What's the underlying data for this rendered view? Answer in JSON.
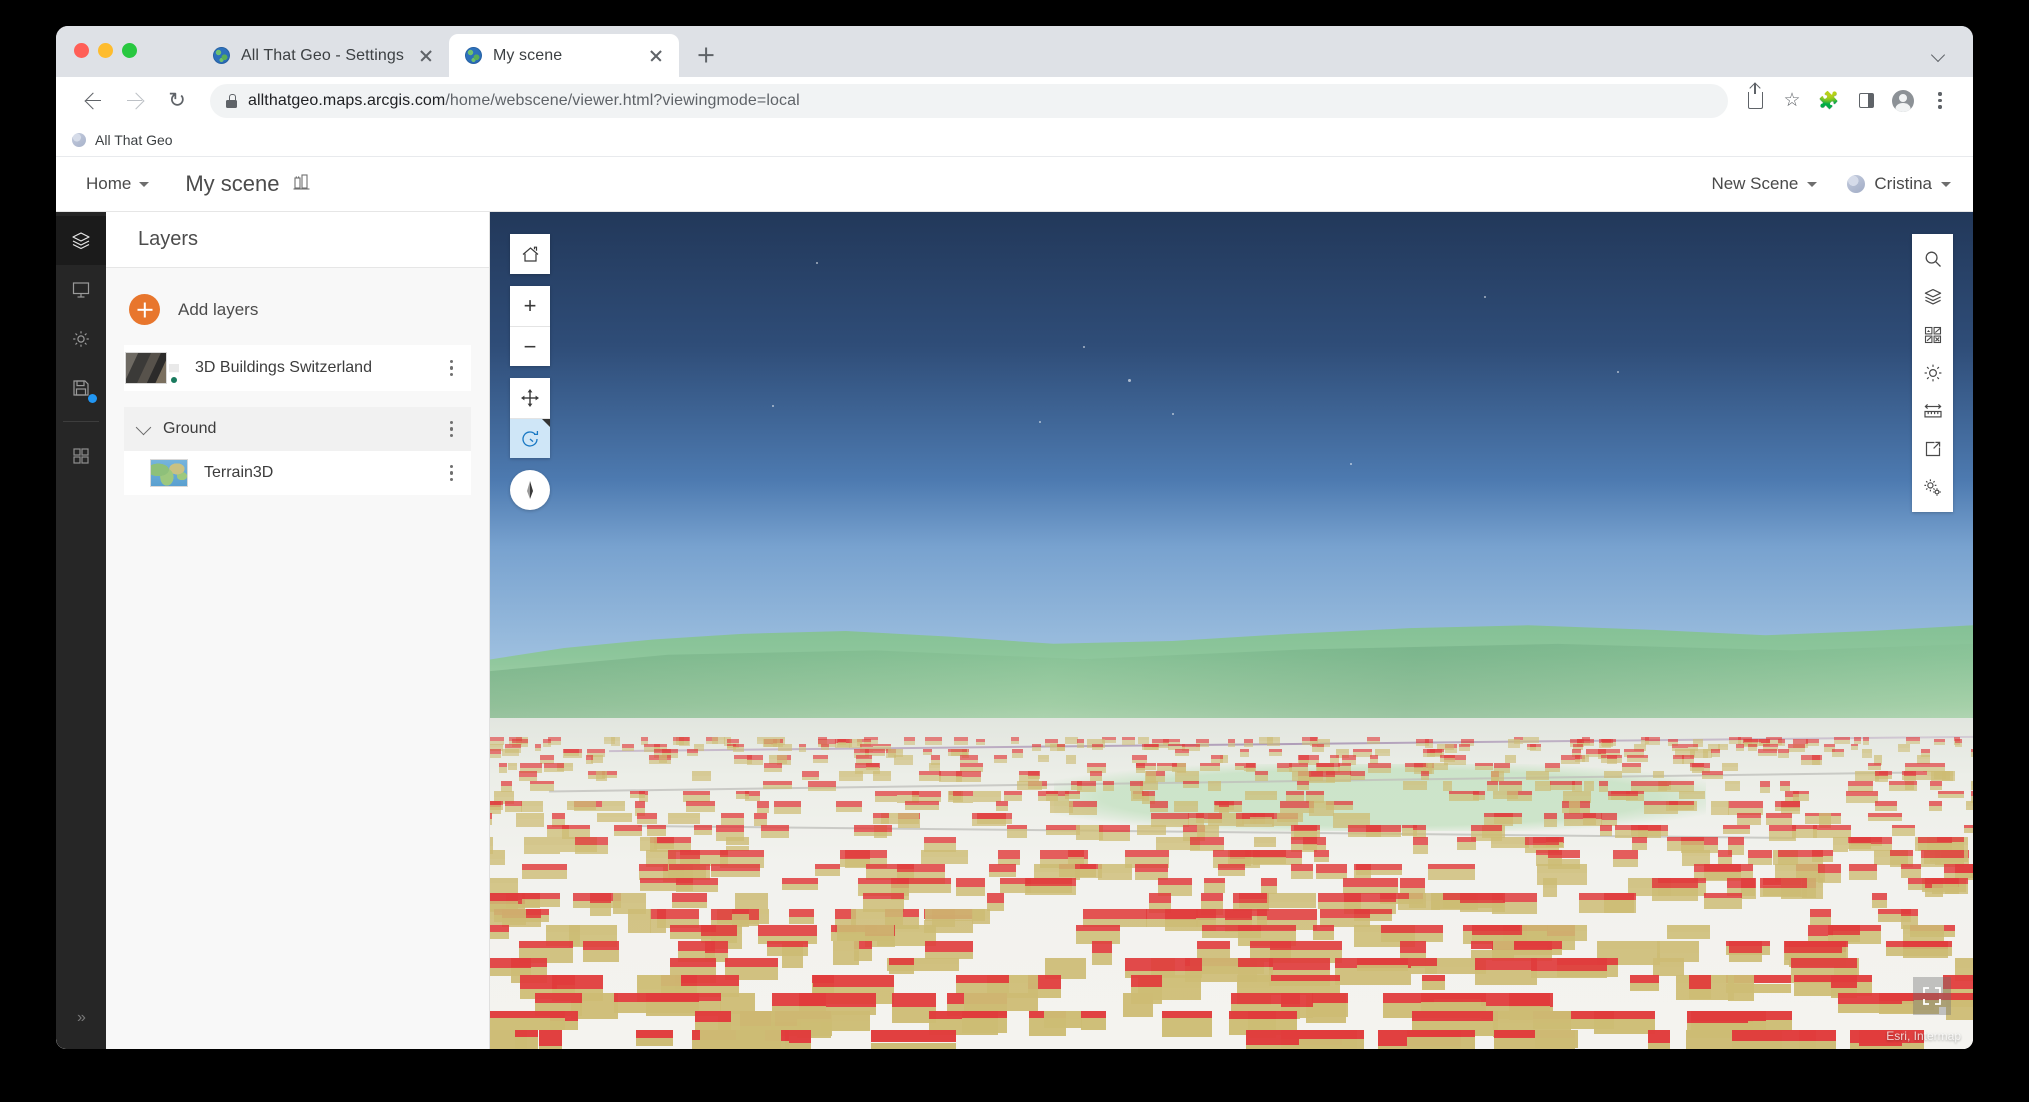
{
  "browser": {
    "tabs": [
      {
        "title": "All That Geo - Settings",
        "active": false,
        "favicon": "globe-favicon"
      },
      {
        "title": "My scene",
        "active": true,
        "favicon": "globe-favicon"
      }
    ],
    "new_tab_label": "+",
    "url_domain": "allthatgeo.maps.arcgis.com",
    "url_path": "/home/webscene/viewer.html?viewingmode=local",
    "toolbar_icons": [
      "share-icon",
      "bookmark-star-icon",
      "extensions-puzzle-icon",
      "side-panel-icon",
      "profile-avatar-icon",
      "chrome-menu-icon"
    ],
    "bookmarks": [
      {
        "label": "All That Geo",
        "favicon": "globe-favicon"
      }
    ]
  },
  "app_header": {
    "home_label": "Home",
    "scene_title": "My scene",
    "scene_icon": "3d-scene-icon",
    "new_scene_label": "New Scene",
    "user_name": "Cristina"
  },
  "rail": {
    "items": [
      {
        "name": "layers",
        "icon": "layers-stack-icon",
        "active": true,
        "badge": false
      },
      {
        "name": "slides",
        "icon": "presentation-icon",
        "active": false,
        "badge": false
      },
      {
        "name": "settings",
        "icon": "gear-icon",
        "active": false,
        "badge": false
      },
      {
        "name": "save",
        "icon": "floppy-save-icon",
        "active": false,
        "badge": true
      }
    ],
    "grid_item": {
      "name": "basemap-gallery",
      "icon": "grid-squares-icon"
    },
    "expand_label": "»"
  },
  "layers_panel": {
    "title": "Layers",
    "add_layers_label": "Add layers",
    "operational_layers": [
      {
        "name": "3D Buildings Switzerland",
        "thumbnail": "urban-aerial-thumbnail",
        "menu": "kebab-menu-icon"
      }
    ],
    "group": {
      "name": "Ground",
      "expanded": true,
      "children": [
        {
          "name": "Terrain3D",
          "thumbnail": "world-map-thumbnail",
          "menu": "kebab-menu-icon"
        }
      ]
    }
  },
  "map_controls": {
    "buttons": [
      {
        "name": "home",
        "icon": "home-icon",
        "symbol": "⌂",
        "active": false
      },
      {
        "name": "zoom-in",
        "icon": "plus-icon",
        "symbol": "+",
        "active": false
      },
      {
        "name": "zoom-out",
        "icon": "minus-icon",
        "symbol": "−",
        "active": false
      },
      {
        "name": "pan",
        "icon": "pan-arrows-icon",
        "symbol": "✥",
        "active": false
      },
      {
        "name": "rotate",
        "icon": "rotate-icon",
        "symbol": "↺",
        "active": true
      }
    ],
    "compass": {
      "name": "compass",
      "icon": "compass-needle-icon"
    }
  },
  "right_toolbar": {
    "items": [
      {
        "name": "search",
        "icon": "search-icon"
      },
      {
        "name": "layers",
        "icon": "layers-stack-icon"
      },
      {
        "name": "basemap",
        "icon": "basemap-grid-icon"
      },
      {
        "name": "daylight",
        "icon": "sun-daylight-icon"
      },
      {
        "name": "measure",
        "icon": "measure-ruler-icon"
      },
      {
        "name": "share",
        "icon": "share-box-icon"
      },
      {
        "name": "scene-settings",
        "icon": "gears-icon"
      }
    ]
  },
  "scene": {
    "attribution": "Esri, Intermap",
    "fullscreen_icon": "fullscreen-expand-icon",
    "colors": {
      "sky_top": "#22385a",
      "sky_horizon": "#b9d0e6",
      "hills": "#8dc69b",
      "ground": "#f2f2ee",
      "building_roof": "#e03c3c",
      "building_wall": "#cdbc74",
      "accent_orange": "#e8762d",
      "active_blue": "#cfe6f7"
    }
  }
}
